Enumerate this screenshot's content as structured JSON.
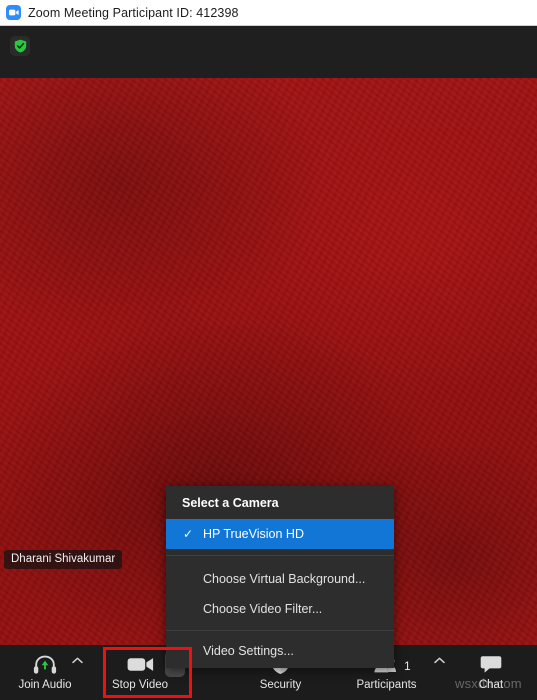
{
  "window": {
    "title": "Zoom Meeting Participant ID: 412398",
    "logo_icon": "zoom-video-logo-icon"
  },
  "meeting_header": {
    "encryption_icon": "green-shield-check-icon"
  },
  "video": {
    "participant_name": "Dharani Shivakumar",
    "background_color": "#9c1111"
  },
  "camera_menu": {
    "header": "Select a Camera",
    "items": [
      {
        "label": "HP TrueVision HD",
        "selected": true,
        "check": "✓"
      },
      {
        "label": "Choose Virtual Background...",
        "selected": false
      },
      {
        "label": "Choose Video Filter...",
        "selected": false
      },
      {
        "label": "Video Settings...",
        "selected": false
      }
    ],
    "highlight_color": "#1176d6",
    "background_color": "#2d2d2d"
  },
  "toolbar": {
    "join_audio_label": "Join Audio",
    "join_audio_icon": "headset-join-audio-icon",
    "join_audio_caret": "˄",
    "stop_video_label": "Stop Video",
    "stop_video_icon": "video-camera-icon",
    "stop_video_caret": "˄",
    "security_label": "Security",
    "security_icon": "shield-icon",
    "participants_label": "Participants",
    "participants_icon": "people-icon",
    "participants_count": "1",
    "participants_caret": "˄",
    "chat_label": "Chat",
    "chat_icon": "speech-bubble-icon",
    "background_color": "#1c1c1c"
  },
  "annotation": {
    "target": "stop-video-button",
    "color": "#ee1111"
  },
  "watermark": {
    "text": "wsxdn.com"
  }
}
